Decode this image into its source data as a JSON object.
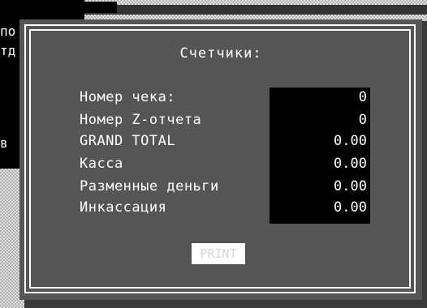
{
  "background": {
    "left_panel_letters": [
      "по",
      "тд",
      "в"
    ]
  },
  "dialog": {
    "title": "Счетчики:",
    "rows": [
      {
        "label": "Номер чека:",
        "value": "0"
      },
      {
        "label": "Номер Z-отчета",
        "value": "0"
      },
      {
        "label": "GRAND TOTAL",
        "value": "0.00"
      },
      {
        "label": "Касса",
        "value": "0.00"
      },
      {
        "label": "Разменные деньги",
        "value": "0.00"
      },
      {
        "label": "Инкассация",
        "value": "0.00"
      }
    ],
    "print_button_label": "PRINT"
  },
  "colors": {
    "dialog_bg": "#555555",
    "frame": "#ffffff",
    "values_panel": "#000000",
    "text": "#ffffff"
  }
}
